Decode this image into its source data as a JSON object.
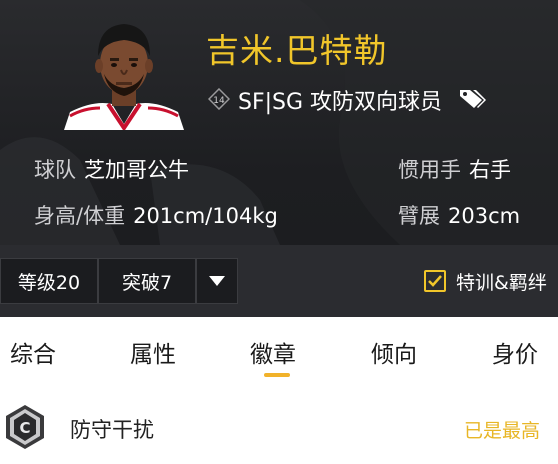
{
  "player": {
    "name": "吉米.巴特勒",
    "number": "14",
    "position": "SF|SG 攻防双向球员"
  },
  "info": {
    "team_label": "球队",
    "team_value": "芝加哥公牛",
    "hand_label": "惯用手",
    "hand_value": "右手",
    "body_label": "身高/体重",
    "body_value": "201cm/104kg",
    "wingspan_label": "臂展",
    "wingspan_value": "203cm"
  },
  "toolbar": {
    "level_label": "等级20",
    "breakthrough_label": "突破7",
    "special_training_label": "特训&羁绊",
    "special_training_checked": true
  },
  "tabs": [
    {
      "label": "综合"
    },
    {
      "label": "属性"
    },
    {
      "label": "徽章",
      "active": true
    },
    {
      "label": "倾向"
    },
    {
      "label": "身价"
    }
  ],
  "badge": {
    "tier_letter": "C",
    "name": "防守干扰",
    "status": "已是最高"
  },
  "colors": {
    "accent": "#f1c62a",
    "header_bg": "#222326",
    "toolbar_bg": "#2b2c30",
    "status": "#e8b626"
  }
}
